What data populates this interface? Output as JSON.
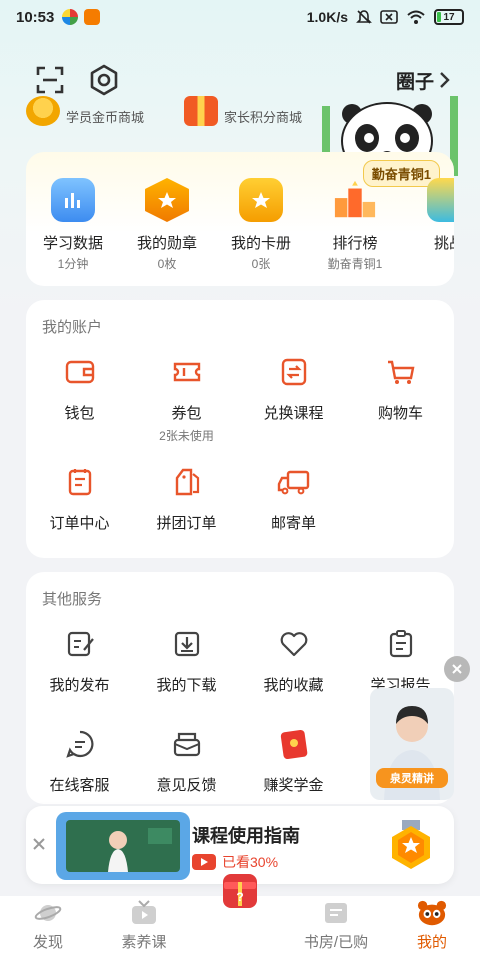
{
  "status_bar": {
    "time": "10:53",
    "network_speed": "1.0K/s",
    "battery": "17"
  },
  "header": {
    "circle_label": "圈子"
  },
  "mall": [
    {
      "label": "学员金币商城"
    },
    {
      "label": "家长积分商城"
    }
  ],
  "study": {
    "rank_tag": "勤奋青铜1",
    "items": [
      {
        "label": "学习数据",
        "sub": "1分钟",
        "icon": "chart-icon"
      },
      {
        "label": "我的勋章",
        "sub": "0枚",
        "icon": "medal-icon"
      },
      {
        "label": "我的卡册",
        "sub": "0张",
        "icon": "card-album-icon"
      },
      {
        "label": "排行榜",
        "sub": "勤奋青铜1",
        "icon": "podium-icon"
      },
      {
        "label": "挑战",
        "sub": "",
        "icon": "challenge-icon"
      }
    ]
  },
  "account": {
    "title": "我的账户",
    "items": [
      {
        "label": "钱包",
        "sub": "",
        "icon": "wallet-icon"
      },
      {
        "label": "券包",
        "sub": "2张未使用",
        "icon": "ticket-icon"
      },
      {
        "label": "兑换课程",
        "sub": "",
        "icon": "exchange-icon"
      },
      {
        "label": "购物车",
        "sub": "",
        "icon": "cart-icon"
      },
      {
        "label": "订单中心",
        "sub": "",
        "icon": "order-icon"
      },
      {
        "label": "拼团订单",
        "sub": "",
        "icon": "group-order-icon"
      },
      {
        "label": "邮寄单",
        "sub": "",
        "icon": "truck-icon"
      }
    ]
  },
  "other": {
    "title": "其他服务",
    "items": [
      {
        "label": "我的发布",
        "icon": "edit-icon"
      },
      {
        "label": "我的下载",
        "icon": "download-icon"
      },
      {
        "label": "我的收藏",
        "icon": "heart-icon"
      },
      {
        "label": "学习报告",
        "icon": "clipboard-icon"
      },
      {
        "label": "在线客服",
        "icon": "chat-icon"
      },
      {
        "label": "意见反馈",
        "icon": "feedback-icon"
      },
      {
        "label": "赚奖学金",
        "icon": "red-envelope-icon"
      }
    ]
  },
  "floating_video": {
    "tag": "泉灵精讲"
  },
  "guide": {
    "title": "课程使用指南",
    "progress": "已看30%"
  },
  "tabs": [
    {
      "label": "发现",
      "icon": "planet-icon",
      "active": false
    },
    {
      "label": "素养课",
      "icon": "tv-icon",
      "active": false
    },
    {
      "label": "",
      "icon": "gift-icon",
      "active": false
    },
    {
      "label": "书房/已购",
      "icon": "book-icon",
      "active": false
    },
    {
      "label": "我的",
      "icon": "panda-icon",
      "active": true
    }
  ],
  "colors": {
    "accent": "#e8552b",
    "active_tab": "#e05a00",
    "progress": "#e8442e"
  }
}
